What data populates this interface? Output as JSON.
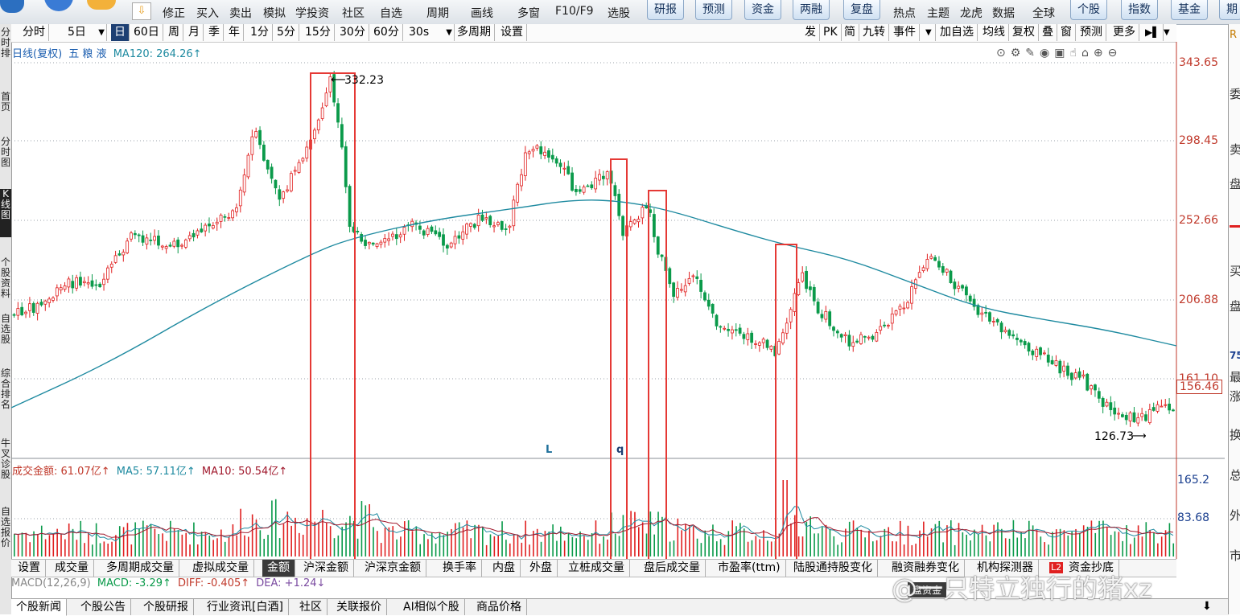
{
  "toolbar": {
    "items": [
      "修正",
      "买入",
      "卖出",
      "模拟",
      "学投资",
      "社区",
      "自选",
      "周期",
      "画线",
      "多窗",
      "F10/F9",
      "选股"
    ],
    "buttons": [
      "研报",
      "预测",
      "资金",
      "两融",
      "复盘"
    ],
    "items2": [
      "热点",
      "主题",
      "龙虎",
      "数据",
      "全球"
    ],
    "buttons2": [
      "个股",
      "指数",
      "基金",
      "期"
    ]
  },
  "periods": [
    "分时",
    "5日",
    "日",
    "60日",
    "周",
    "月",
    "季",
    "年",
    "1分",
    "5分",
    "15分",
    "30分",
    "60分",
    "30s",
    "多周期",
    "设置"
  ],
  "period_selected": "日",
  "right_tools": [
    "发",
    "PK",
    "简",
    "九转",
    "事件",
    "加自选",
    "均线",
    "复权",
    "叠",
    "窗",
    "预测",
    "更多"
  ],
  "left_strip": [
    "分时排",
    "首页",
    "分时图",
    "K线图",
    "个股资料",
    "自选股",
    "综合排名",
    "牛叉诊股",
    "自选报价"
  ],
  "left_strip_selected": "K线图",
  "right_panel": [
    "R",
    "委",
    "卖",
    "盘",
    "买",
    "盘",
    "75",
    "最",
    "涨",
    "换",
    "总",
    "外",
    "市"
  ],
  "legend": {
    "title": "日线(复权)",
    "stock": "五 粮 液",
    "ma120": "MA120: 264.26↑"
  },
  "price_axis": [
    "343.65",
    "298.45",
    "252.66",
    "206.88",
    "161.10",
    "156.46"
  ],
  "current_price_label": "156.46",
  "annotations": {
    "high": "332.23",
    "low": "126.73",
    "mark_l": "L",
    "mark_q": "q"
  },
  "volume_legend": {
    "amount": "成交金额: 61.07亿↑",
    "ma5": "MA5: 57.11亿↑",
    "ma10": "MA10: 50.54亿↑"
  },
  "volume_axis": [
    "165.2",
    "83.68"
  ],
  "indicator_tabs": [
    "设置",
    "成交量",
    "多周期成交量",
    "虚拟成交量",
    "金额",
    "沪深金额",
    "沪深京金额",
    "换手率",
    "内盘",
    "外盘",
    "立桩成交量",
    "盘后成交量",
    "市盈率(ttm)",
    "陆股通持股变化",
    "融资融券变化",
    "机构探测器",
    "L2",
    "资金抄底"
  ],
  "indicator_selected": "金额",
  "macd": {
    "label": "MACD(12,26,9)",
    "macd": "MACD: -3.29↑",
    "diff": "DIFF: -0.405↑",
    "dea": "DEA: +1.24↓"
  },
  "news_tabs": [
    "个股新闻",
    "个股公告",
    "个股研报",
    "行业资讯[白酒]",
    "社区",
    "关联报价",
    "AI相似个股",
    "商品价格"
  ],
  "news_selected": "个股新闻",
  "floating_button": "盘资金",
  "watermark": "@一只特立独行的猪xz",
  "colors": {
    "up": "#e02020",
    "down": "#0a9a4a",
    "ma": "#1e8aa0",
    "highlight": "#e53935",
    "axis_red": "#c0392b"
  }
}
